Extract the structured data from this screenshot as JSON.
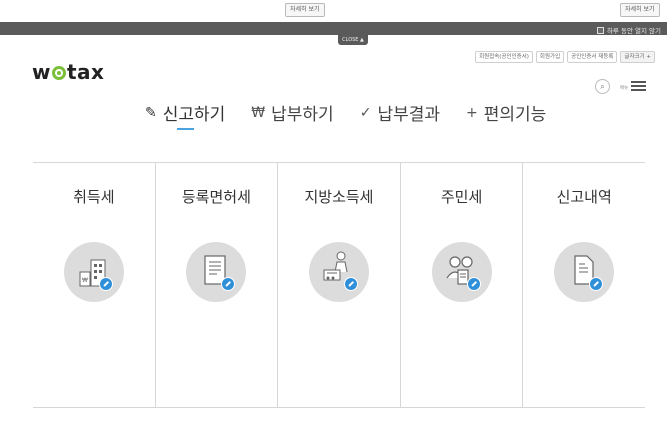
{
  "top_bar": {
    "detail_button_center": "자세히 보기",
    "detail_button_right": "자세히 보기",
    "hide_today": "하루 동안 열지 않기",
    "close_tab": "CLOSE ▲"
  },
  "header": {
    "logo_text_left": "w",
    "logo_text_right": "tax",
    "util_links": [
      "회원접속(공인인증서)",
      "회원가입",
      "공인인증서 재등록",
      "글자크기 +"
    ],
    "menu_label": "메뉴"
  },
  "main_nav": [
    {
      "icon": "✓",
      "icon_name": "pencil-icon",
      "label": "신고하기"
    },
    {
      "icon": "₩",
      "icon_name": "won-icon",
      "label": "납부하기"
    },
    {
      "icon": "✓",
      "icon_name": "check-icon",
      "label": "납부결과"
    },
    {
      "icon": "+",
      "icon_name": "plus-icon",
      "label": "편의기능"
    }
  ],
  "cards": [
    {
      "title": "취득세",
      "icon": "building-icon"
    },
    {
      "title": "등록면허세",
      "icon": "document-icon"
    },
    {
      "title": "지방소득세",
      "icon": "worker-icon"
    },
    {
      "title": "주민세",
      "icon": "people-icon"
    },
    {
      "title": "신고내역",
      "icon": "file-icon"
    }
  ],
  "colors": {
    "accent": "#4aa3df",
    "brand_green": "#7cbf3a",
    "badge_blue": "#2f8fd8"
  }
}
